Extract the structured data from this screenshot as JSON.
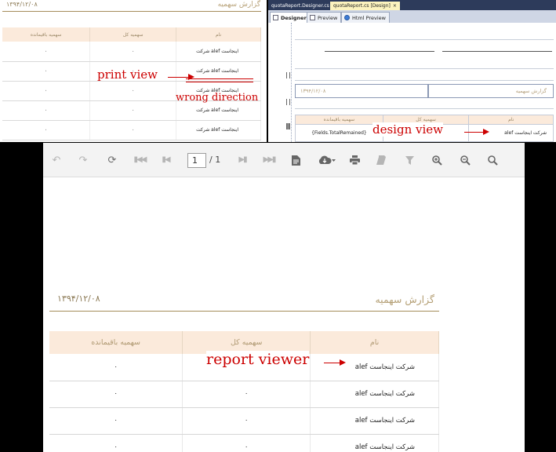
{
  "print_view": {
    "title": "گزارش سهمیه",
    "date": "۱۳۹۴/۱۲/۰۸",
    "columns": [
      "سهمیه باقیمانده",
      "سهمیه کل",
      "نام"
    ],
    "rows": [
      {
        "remained": "۰",
        "total": "۰",
        "name": "اینجاست alef شرکت"
      },
      {
        "remained": "۰",
        "total": "۰",
        "name": "اینجاست alef شرکت"
      },
      {
        "remained": "۰",
        "total": "۰",
        "name": "اینجاست alef شرکت"
      },
      {
        "remained": "۰",
        "total": "۰",
        "name": "اینجاست alef شرکت"
      },
      {
        "remained": "۰",
        "total": "۰",
        "name": "اینجاست alef شرکت"
      }
    ]
  },
  "designer": {
    "doc_tabs": [
      "quotaReport.Designer.cs",
      "quotaReport.cs [Design]"
    ],
    "close_glyph": "×",
    "view_tabs": [
      "Designer",
      "Preview",
      "Html Preview"
    ],
    "title": "گزارش سهمیه",
    "date": "۱۳۹۴/۱۲/۰۸",
    "columns": [
      "سهمیه باقیمانده",
      "سهمیه کل",
      "نام"
    ],
    "row": {
      "remained": "{Fields.TotalRemained}",
      "total": "",
      "name": "شرکت اینجاست alef"
    }
  },
  "viewer": {
    "toolbar": {
      "page_value": "1",
      "page_total": "/ 1",
      "icons": [
        "undo-icon",
        "redo-icon",
        "refresh-icon",
        "first-page-icon",
        "previous-page-icon",
        "next-page-icon",
        "last-page-icon",
        "document-map-icon",
        "export-icon",
        "print-icon",
        "print-layout-icon",
        "filter-icon",
        "zoom-in-icon",
        "zoom-out-icon",
        "search-icon"
      ]
    },
    "title": "گزارش سهمیه",
    "date": "۱۳۹۴/۱۲/۰۸",
    "columns": [
      "سهمیه باقیمانده",
      "سهمیه کل",
      "نام"
    ],
    "rows": [
      {
        "remained": "۰",
        "total": "",
        "name": "شرکت اینجاست alef"
      },
      {
        "remained": "۰",
        "total": "۰",
        "name": "شرکت اینجاست alef"
      },
      {
        "remained": "۰",
        "total": "۰",
        "name": "شرکت اینجاست alef"
      },
      {
        "remained": "۰",
        "total": "۰",
        "name": "شرکت اینجاست alef"
      }
    ]
  },
  "annotations": {
    "print_view": "print view",
    "wrong_direction": "wrong direction",
    "design_view": "design view",
    "report_viewer": "report viewer"
  },
  "colors": {
    "header_fill": "#fbeadb",
    "title_text": "#b5a076",
    "rule": "#a58d5b",
    "annotation": "#cc0000",
    "tab_strip": "#2d3b5b",
    "active_tab": "#fdf4bf"
  }
}
